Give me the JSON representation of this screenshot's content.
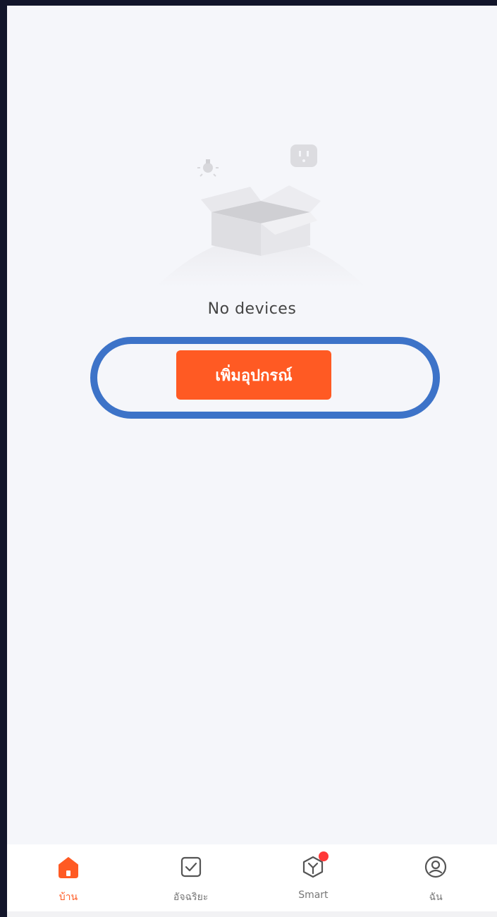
{
  "empty_state": {
    "message": "No devices",
    "illustration_icons": [
      "lightbulb-icon",
      "box-icon",
      "socket-icon"
    ]
  },
  "add_device_button": {
    "label": "เพิ่มอุปกรณ์",
    "color": "#ff5a23"
  },
  "highlight": {
    "color": "#3d73c8"
  },
  "tabbar": {
    "tabs": [
      {
        "label": "บ้าน",
        "icon": "home-icon",
        "active": true
      },
      {
        "label": "อัจฉริยะ",
        "icon": "checkbox-icon",
        "active": false
      },
      {
        "label": "Smart",
        "icon": "smart-cube-icon",
        "active": false,
        "badge": true
      },
      {
        "label": "ฉัน",
        "icon": "user-icon",
        "active": false
      }
    ]
  },
  "colors": {
    "accent": "#ff5a23",
    "badge": "#ff3838",
    "background": "#f5f6fa"
  }
}
